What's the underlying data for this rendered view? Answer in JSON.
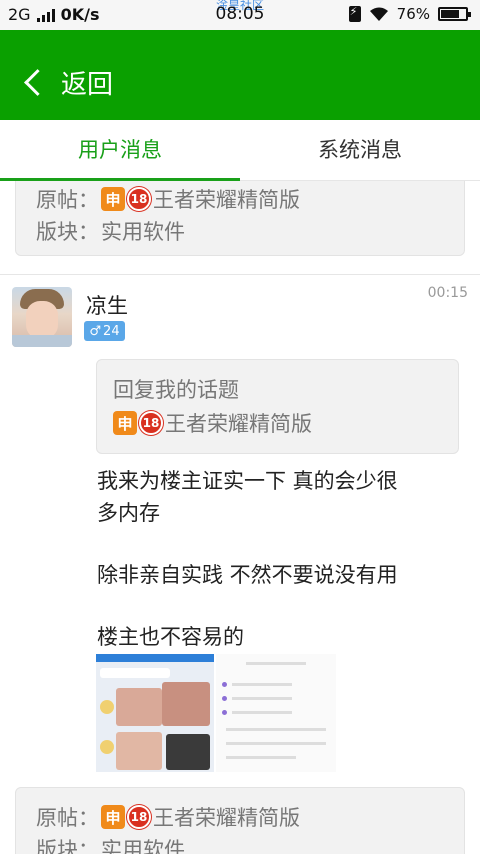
{
  "status_bar": {
    "network": "2G",
    "speed": "0K/s",
    "time": "08:05",
    "ghost_title": "淦皇社区",
    "battery": "76%",
    "battery_level": 0.76
  },
  "header": {
    "back_label": "返回"
  },
  "tabs": [
    {
      "label": "用户消息",
      "active": true
    },
    {
      "label": "系统消息",
      "active": false
    }
  ],
  "posts_top": {
    "origin_label": "原帖：",
    "origin_title": "王者荣耀精简版",
    "board_label": "版块：",
    "board_name": "实用软件"
  },
  "message": {
    "username": "凉生",
    "gender_symbol": "♂",
    "age": "24",
    "time": "00:15",
    "reply_heading": "回复我的话题",
    "reply_title": "王者荣耀精简版",
    "badge_shen": "申",
    "badge_18": "18",
    "text_line1": "我来为楼主证实一下 真的会少很",
    "text_line2": "多内存",
    "text_line3": "除非亲自实践 不然不要说没有用",
    "text_line4": "楼主也不容易的"
  },
  "posts_bottom": {
    "origin_label": "原帖：",
    "origin_title": "王者荣耀精简版",
    "board_label": "版块：",
    "board_name": "实用软件"
  },
  "colors": {
    "accent": "#0aa000",
    "tab_active": "#19a019"
  }
}
